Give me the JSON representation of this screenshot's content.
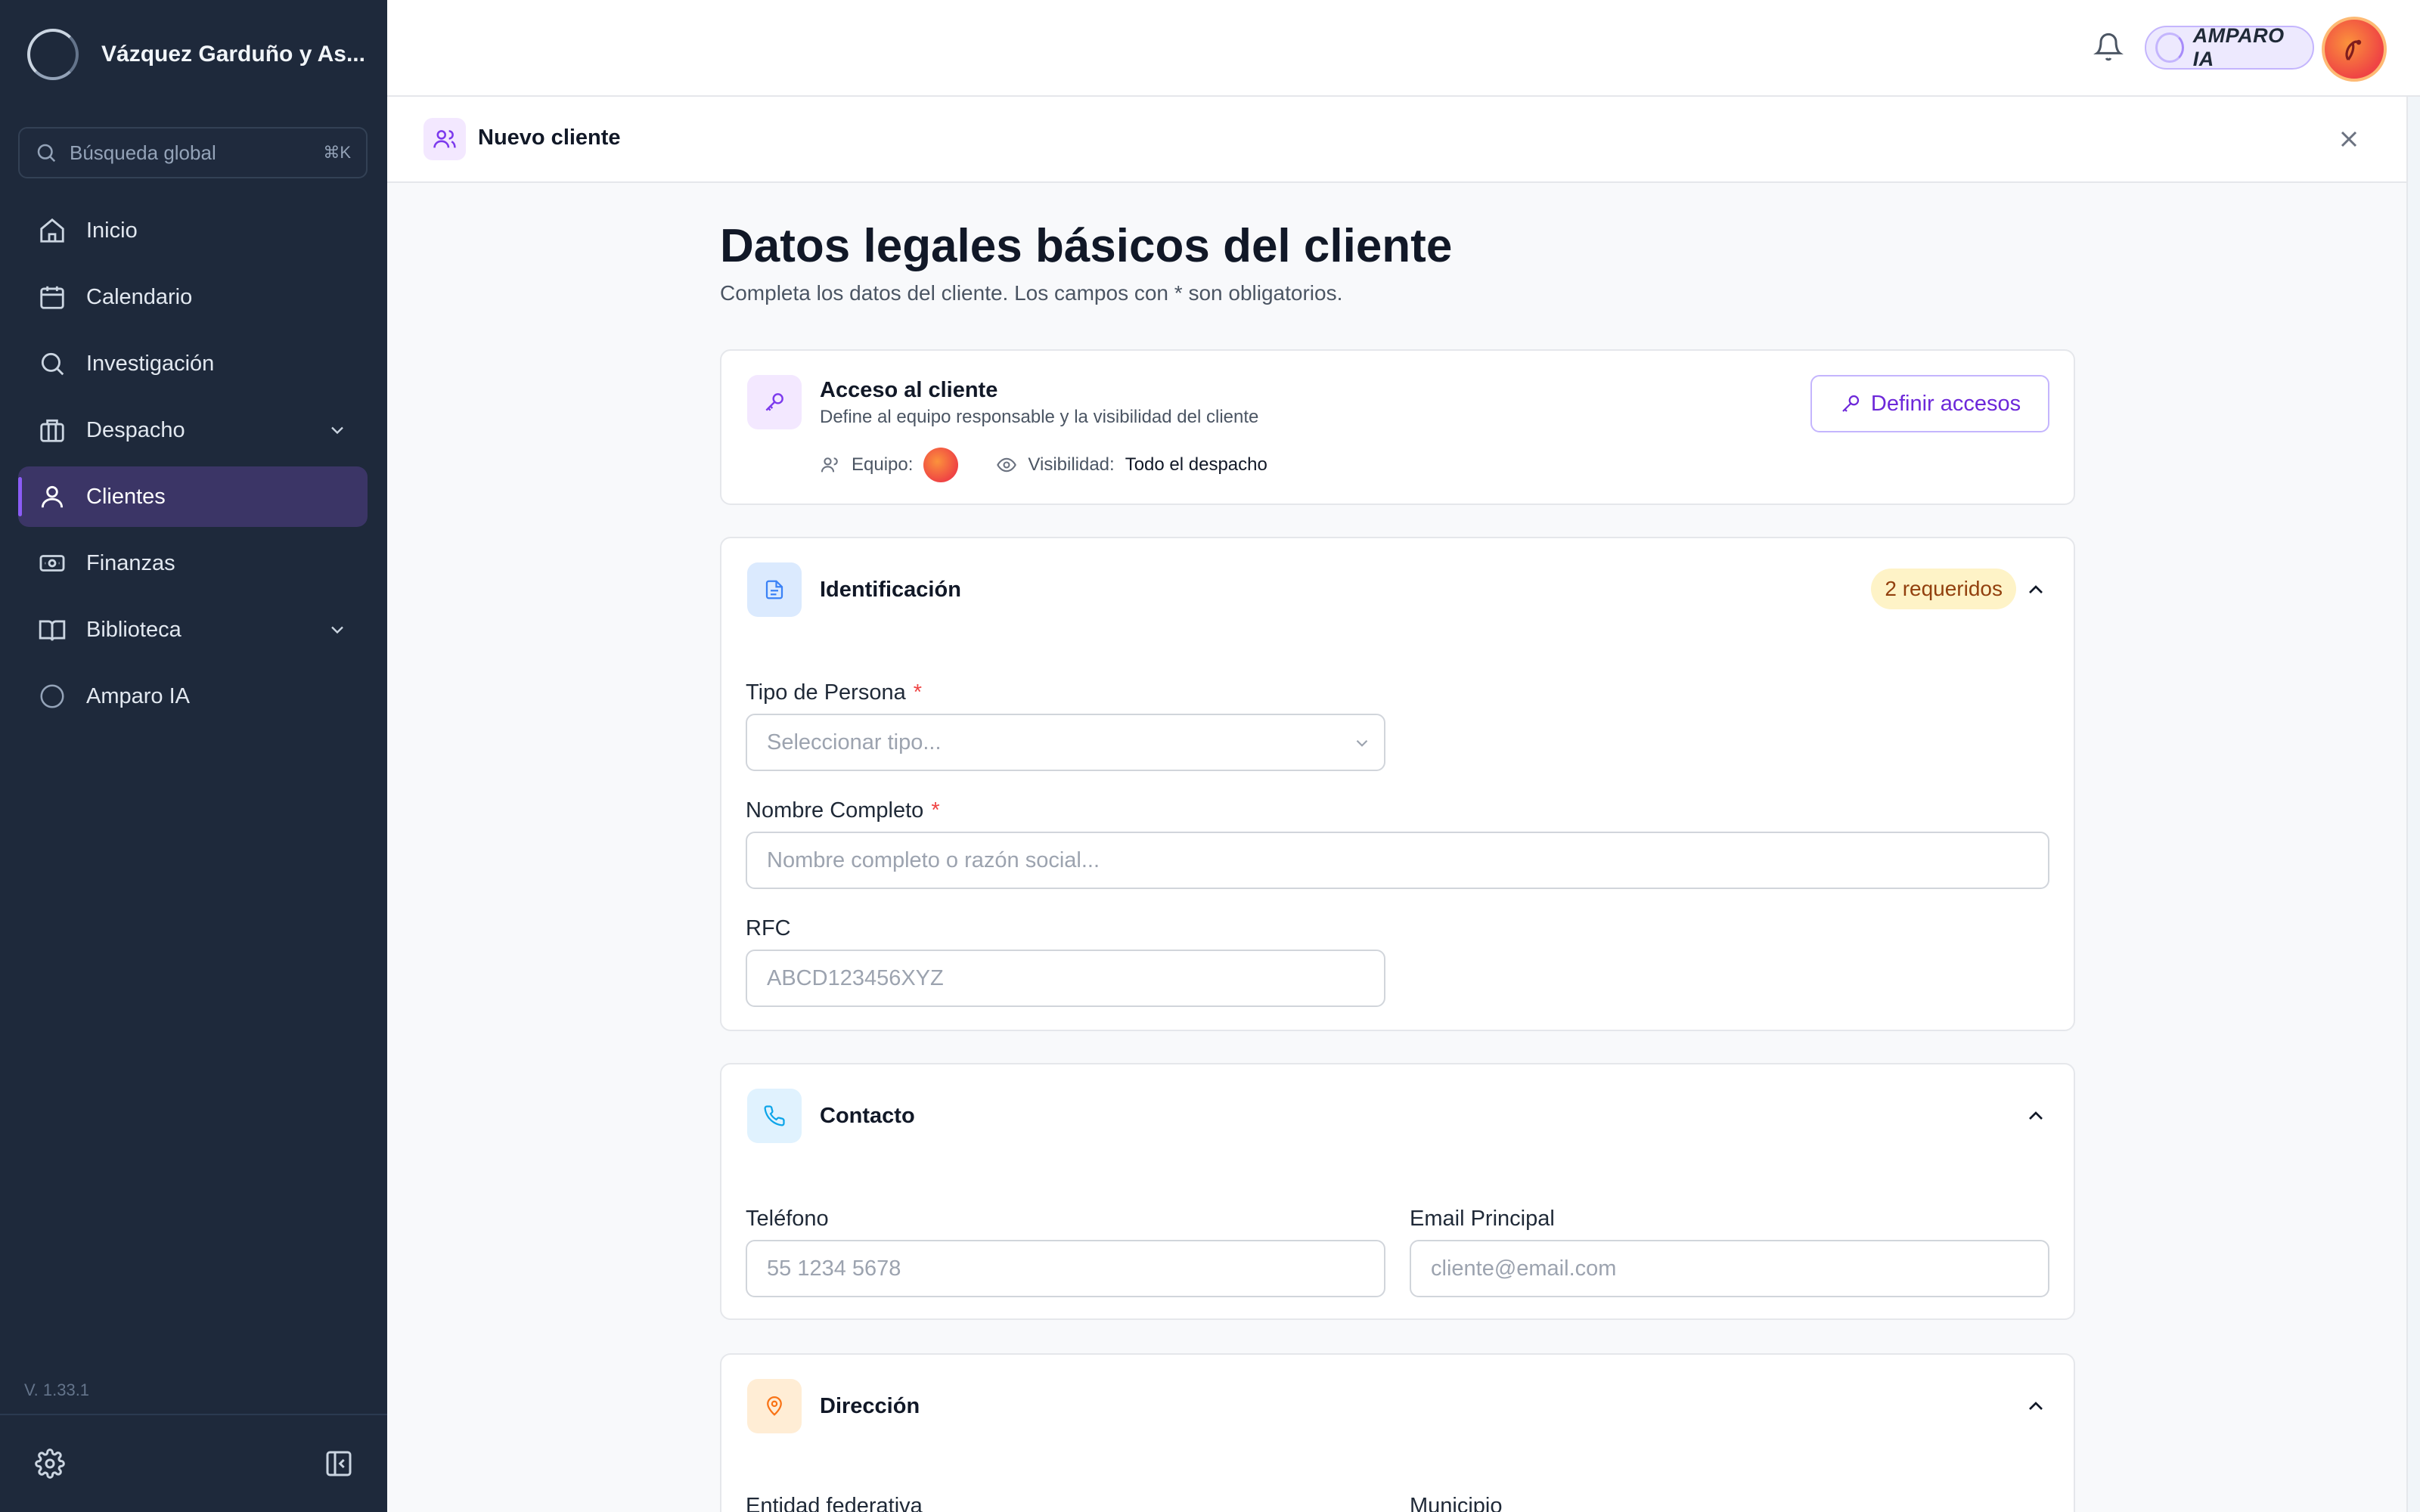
{
  "sidebar": {
    "brand": "Vázquez Garduño y As...",
    "search": {
      "placeholder": "Búsqueda global",
      "shortcut": "⌘K"
    },
    "items": [
      {
        "label": "Inicio",
        "icon": "home-icon"
      },
      {
        "label": "Calendario",
        "icon": "calendar-icon"
      },
      {
        "label": "Investigación",
        "icon": "search-icon"
      },
      {
        "label": "Despacho",
        "icon": "briefcase-icon",
        "expandable": true
      },
      {
        "label": "Clientes",
        "icon": "user-icon",
        "active": true
      },
      {
        "label": "Finanzas",
        "icon": "money-icon"
      },
      {
        "label": "Biblioteca",
        "icon": "book-icon",
        "expandable": true
      },
      {
        "label": "Amparo IA",
        "icon": "amparo-circle-icon"
      }
    ],
    "version": "V. 1.33.1"
  },
  "topbar": {
    "assistant_label": "AMPARO IA"
  },
  "panel": {
    "title": "Nuevo cliente"
  },
  "page": {
    "title": "Datos legales básicos del cliente",
    "subtitle": "Completa los datos del cliente. Los campos con * son obligatorios."
  },
  "access": {
    "title": "Acceso al cliente",
    "subtitle": "Define al equipo responsable y la visibilidad del cliente",
    "team_label": "Equipo:",
    "visibility_label": "Visibilidad:",
    "visibility_value": "Todo el despacho",
    "button": "Definir accesos"
  },
  "identification": {
    "title": "Identificación",
    "badge": "2 requeridos",
    "person_type": {
      "label": "Tipo de Persona",
      "required": "*",
      "placeholder": "Seleccionar tipo..."
    },
    "full_name": {
      "label": "Nombre Completo",
      "required": "*",
      "placeholder": "Nombre completo o razón social..."
    },
    "rfc": {
      "label": "RFC",
      "placeholder": "ABCD123456XYZ"
    }
  },
  "contact": {
    "title": "Contacto",
    "phone": {
      "label": "Teléfono",
      "placeholder": "55 1234 5678"
    },
    "email": {
      "label": "Email Principal",
      "placeholder": "cliente@email.com"
    }
  },
  "address": {
    "title": "Dirección",
    "state_label": "Entidad federativa",
    "municipality_label": "Municipio"
  },
  "colors": {
    "sidebar_bg": "#1e293b",
    "active_item_bg": "#3b3566",
    "accent_purple": "#8b5cf6",
    "required_red": "#ef4444",
    "badge_bg": "#fef3c7"
  }
}
